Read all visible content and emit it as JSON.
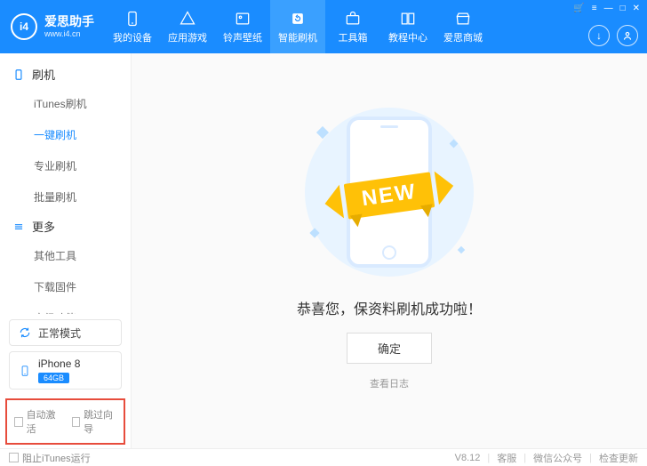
{
  "brand": {
    "logo_letter": "i4",
    "name": "爱思助手",
    "url": "www.i4.cn"
  },
  "nav": [
    {
      "label": "我的设备"
    },
    {
      "label": "应用游戏"
    },
    {
      "label": "铃声壁纸"
    },
    {
      "label": "智能刷机",
      "active": true
    },
    {
      "label": "工具箱"
    },
    {
      "label": "教程中心"
    },
    {
      "label": "爱思商城"
    }
  ],
  "sidebar": {
    "groups": [
      {
        "title": "刷机",
        "items": [
          "iTunes刷机",
          "一键刷机",
          "专业刷机",
          "批量刷机"
        ],
        "active_index": 1
      },
      {
        "title": "更多",
        "items": [
          "其他工具",
          "下载固件",
          "高级功能"
        ]
      }
    ],
    "mode_label": "正常模式",
    "device": {
      "name": "iPhone 8",
      "storage": "64GB"
    },
    "opts": {
      "auto_activate": "自动激活",
      "skip_wizard": "跳过向导"
    }
  },
  "main": {
    "ribbon": "NEW",
    "success": "恭喜您，保资料刷机成功啦！",
    "confirm": "确定",
    "log": "查看日志"
  },
  "footer": {
    "block_itunes": "阻止iTunes运行",
    "version": "V8.12",
    "links": [
      "客服",
      "微信公众号",
      "检查更新"
    ]
  }
}
